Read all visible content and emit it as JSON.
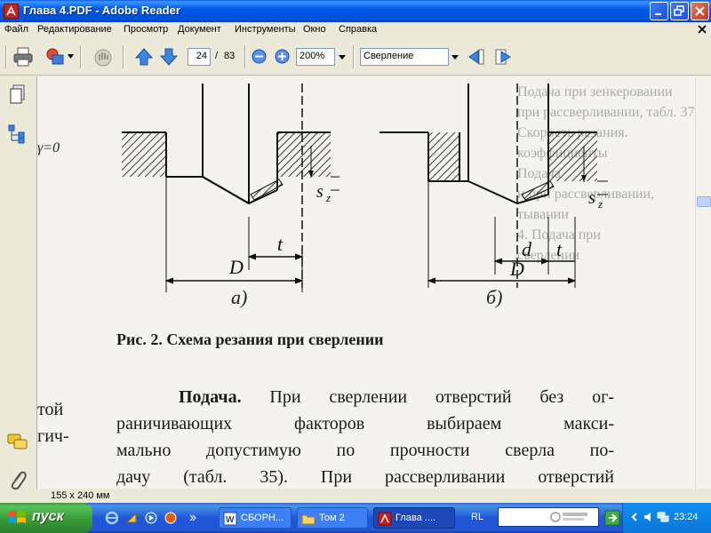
{
  "window": {
    "title": "Глава 4.PDF - Adobe Reader"
  },
  "menu": [
    "Файл",
    "Редактирование",
    "Просмотр",
    "Документ",
    "Инструменты",
    "Окно",
    "Справка"
  ],
  "toolbar": {
    "page_current": "24",
    "page_sep": "/",
    "page_total": "83",
    "zoom": "200%",
    "search_value": "Сверление"
  },
  "document": {
    "gamma_label": "γ=0",
    "fig_a": "а)",
    "fig_b": "б)",
    "labels": {
      "D": "D",
      "t": "t",
      "d": "d",
      "sz": "s",
      "sz_sub": "z"
    },
    "caption": "Рис. 2. Схема резания при сверлении",
    "body_lead": "Подача.",
    "body_lines": [
      " При сверлении отверстий без ог-",
      "раничивающих факторов выбираем макси-",
      "мально допустимую по прочности сверла по-",
      "дачу (табл. 35). При рассверливании отверстий"
    ],
    "left_fragment": [
      "той",
      "гич-"
    ],
    "bleed_lines": [
      "Подача при зенкеровании",
      "при рассверливании, табл. 37.",
      "Скорость резания.",
      "коэффициенты",
      "",
      "Подача",
      "",
      "",
      "",
      "и при рассверливании,",
      "тывании",
      "",
      "",
      "4. Подача при",
      "сверлении"
    ]
  },
  "status": {
    "page_size": "155 x 240 мм"
  },
  "taskbar": {
    "start": "пуск",
    "tasks": [
      "СБОРН...",
      "Том 2",
      "Глава ...."
    ],
    "lang": "RL",
    "clock": "23:24"
  },
  "colors": {
    "title_bar": "#0058e6",
    "start_button": "#379c37",
    "taskbar": "#2157d7"
  }
}
